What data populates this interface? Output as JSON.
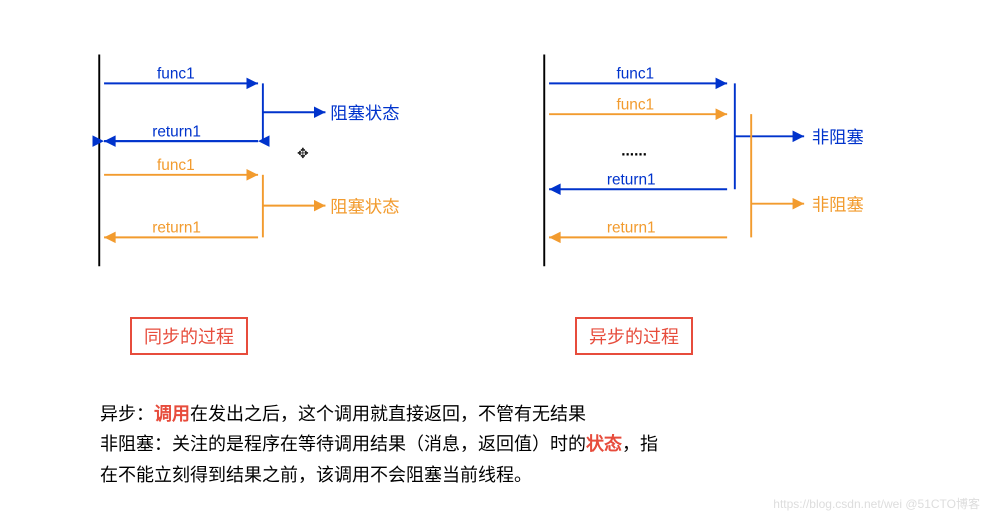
{
  "left": {
    "line1": "func1",
    "line2": "return1",
    "line3": "func1",
    "line4": "return1",
    "state1": "阻塞状态",
    "state2": "阻塞状态",
    "caption": "同步的过程"
  },
  "right": {
    "line1": "func1",
    "line2": "func1",
    "dots": "......",
    "line3": "return1",
    "line4": "return1",
    "state1": "非阻塞",
    "state2": "非阻塞",
    "caption": "异步的过程"
  },
  "explanation": {
    "row1_prefix": "异步：",
    "row1_red": "调用",
    "row1_rest": "在发出之后，这个调用就直接返回，不管有无结果",
    "row2_prefix": "非阻塞：关注的是程序在等待调用结果（消息，返回值）时的",
    "row2_red": "状态",
    "row2_rest": "，指",
    "row3": "在不能立刻得到结果之前，该调用不会阻塞当前线程。"
  },
  "watermark": "https://blog.csdn.net/wei @51CTO博客",
  "colors": {
    "blue": "#0033cc",
    "orange": "#f29b2e",
    "red": "#e74c3c"
  }
}
